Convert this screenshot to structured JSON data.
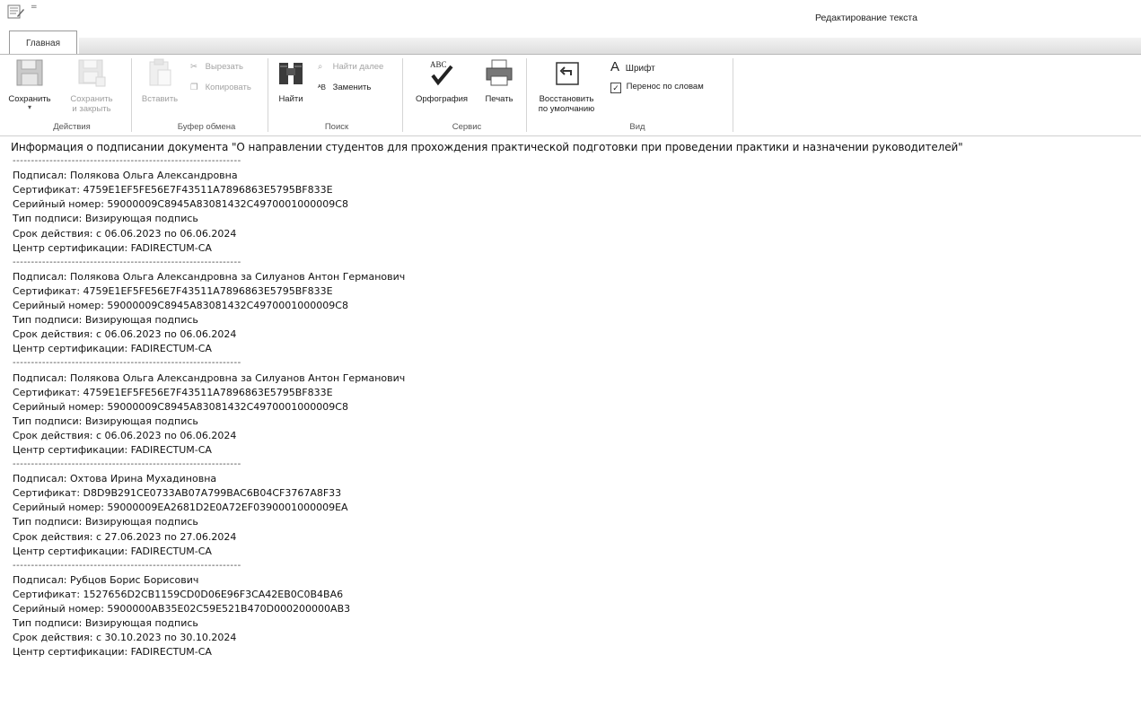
{
  "window": {
    "title": "Редактирование текста",
    "quick_access_dropdown": "="
  },
  "tabs": [
    {
      "label": "Главная",
      "active": true
    }
  ],
  "ribbon": {
    "groups": [
      {
        "label": "Действия",
        "buttons": [
          {
            "label": "Сохранить",
            "icon": "floppy-disk-icon",
            "enabled": true
          },
          {
            "label": "Сохранить и закрыть",
            "line1": "Сохранить",
            "line2": "и закрыть",
            "icon": "floppy-disk-close-icon",
            "enabled": false
          }
        ]
      },
      {
        "label": "Буфер обмена",
        "buttons": [
          {
            "label": "Вставить",
            "icon": "paste-icon",
            "enabled": false
          },
          {
            "label": "Вырезать",
            "icon": "scissors-icon",
            "enabled": false
          },
          {
            "label": "Копировать",
            "icon": "copy-icon",
            "enabled": false
          }
        ]
      },
      {
        "label": "Поиск",
        "buttons": [
          {
            "label": "Найти",
            "icon": "binoculars-icon",
            "enabled": true
          },
          {
            "label": "Найти далее",
            "icon": "find-next-icon",
            "enabled": false
          },
          {
            "label": "Заменить",
            "icon": "replace-icon",
            "enabled": true
          }
        ]
      },
      {
        "label": "Сервис",
        "buttons": [
          {
            "label": "Орфография",
            "icon": "spellcheck-icon",
            "icon_text": "ABC",
            "enabled": true
          },
          {
            "label": "Печать",
            "icon": "printer-icon",
            "enabled": true
          }
        ]
      },
      {
        "label": "Вид",
        "buttons": [
          {
            "label": "Восстановить по умолчанию",
            "line1": "Восстановить",
            "line2": "по умолчанию",
            "icon": "restore-icon",
            "enabled": true
          },
          {
            "label": "Шрифт",
            "icon": "font-icon",
            "icon_text": "A",
            "enabled": true
          },
          {
            "label": "Перенос по словам",
            "icon": "checkbox-icon",
            "checked": true,
            "enabled": true
          }
        ]
      }
    ]
  },
  "document": {
    "title": "Информация о подписании документа \"О направлении студентов для прохождения практической подготовки при проведении практики и назначении руководителей\"",
    "separator": "--------------------------------------------------------------",
    "signatures": [
      {
        "signer": "Подписал: Полякова Ольга Александровна",
        "certificate": "Сертификат: 4759E1EF5FE56E7F43511A7896863E5795BF833E",
        "serial": "Серийный номер: 59000009C8945A83081432C4970001000009C8",
        "type": "Тип подписи: Визирующая подпись",
        "validity": "Срок действия: с 06.06.2023 по 06.06.2024",
        "ca": "Центр сертификации: FADIRECTUM-CA"
      },
      {
        "signer": "Подписал: Полякова Ольга Александровна за Силуанов Антон Германович",
        "certificate": "Сертификат: 4759E1EF5FE56E7F43511A7896863E5795BF833E",
        "serial": "Серийный номер: 59000009C8945A83081432C4970001000009C8",
        "type": "Тип подписи: Визирующая подпись",
        "validity": "Срок действия: с 06.06.2023 по 06.06.2024",
        "ca": "Центр сертификации: FADIRECTUM-CA"
      },
      {
        "signer": "Подписал: Полякова Ольга Александровна за Силуанов Антон Германович",
        "certificate": "Сертификат: 4759E1EF5FE56E7F43511A7896863E5795BF833E",
        "serial": "Серийный номер: 59000009C8945A83081432C4970001000009C8",
        "type": "Тип подписи: Визирующая подпись",
        "validity": "Срок действия: с 06.06.2023 по 06.06.2024",
        "ca": "Центр сертификации: FADIRECTUM-CA"
      },
      {
        "signer": "Подписал: Охтова Ирина Мухадиновна",
        "certificate": "Сертификат: D8D9B291CE0733AB07A799BAC6B04CF3767A8F33",
        "serial": "Серийный номер: 59000009EA2681D2E0A72EF0390001000009EA",
        "type": "Тип подписи: Визирующая подпись",
        "validity": "Срок действия: с 27.06.2023 по 27.06.2024",
        "ca": "Центр сертификации: FADIRECTUM-CA"
      },
      {
        "signer": "Подписал: Рубцов Борис Борисович",
        "certificate": "Сертификат: 1527656D2CB1159CD0D06E96F3CA42EB0C0B4BA6",
        "serial": "Серийный номер: 5900000AB35E02C59E521B470D000200000AB3",
        "type": "Тип подписи: Визирующая подпись",
        "validity": "Срок действия: с 30.10.2023 по 30.10.2024",
        "ca": "Центр сертификации: FADIRECTUM-CA"
      }
    ]
  }
}
